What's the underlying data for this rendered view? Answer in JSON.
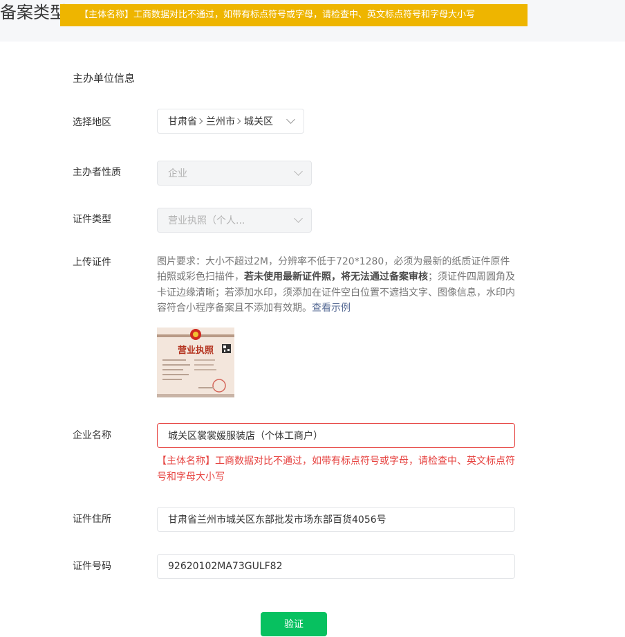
{
  "header": {
    "title": "备案类型",
    "toast": "【主体名称】工商数据对比不通过，如带有标点符号或字母，请检查中、英文标点符号和字母大小写"
  },
  "section": {
    "title": "主办单位信息"
  },
  "region": {
    "label": "选择地区",
    "province": "甘肃省",
    "city": "兰州市",
    "district": "城关区"
  },
  "organizer_type": {
    "label": "主办者性质",
    "value": "企业"
  },
  "cert_type": {
    "label": "证件类型",
    "value": "营业执照（个人..."
  },
  "upload": {
    "label": "上传证件",
    "desc_1": "图片要求：大小不超过2M，分辨率不低于720*1280，必须为最新的纸质证件原件拍照或彩色扫描件，",
    "desc_bold": "若未使用最新证件照，将无法通过备案审核",
    "desc_2": "；须证件四周圆角及卡证边缘清晰；若添加水印，须添加在证件空白位置不遮挡文字、图像信息，水印内容符合小程序备案且不添加有效期。",
    "example_link": "查看示例",
    "image_title": "营业执照"
  },
  "company_name": {
    "label": "企业名称",
    "value": "城关区裳裳媛服装店（个体工商户）",
    "error": "【主体名称】工商数据对比不通过，如带有标点符号或字母，请检查中、英文标点符号和字母大小写"
  },
  "address": {
    "label": "证件住所",
    "value": "甘肃省兰州市城关区东部批发市场东部百货4056号"
  },
  "cert_number": {
    "label": "证件号码",
    "value": "92620102MA73GULF82"
  },
  "verify_button": "验证",
  "colors": {
    "accent": "#07c160",
    "error": "#e64340",
    "toast": "#eeb500",
    "link": "#576b95"
  }
}
